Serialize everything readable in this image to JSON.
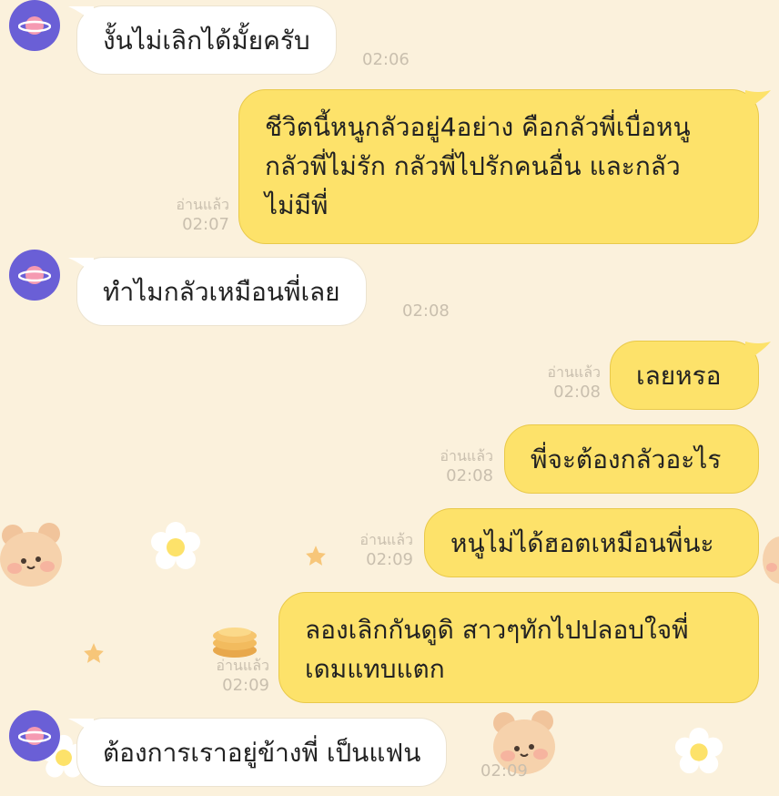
{
  "colors": {
    "background": "#fbf1dc",
    "incoming_bubble": "#ffffff",
    "outgoing_bubble": "#fde26a",
    "avatar": "#6a5fd6"
  },
  "messages": [
    {
      "direction": "incoming",
      "text": "งั้นไม่เลิกได้มั้ยครับ",
      "time": "02:06"
    },
    {
      "direction": "outgoing",
      "lines": [
        "ชีวิตนี้หนูกลัวอยู่4อย่าง คือกลัวพี่เบื่อหนู",
        "กลัวพี่ไม่รัก กลัวพี่ไปรักคนอื่น และกลัว",
        "ไม่มีพี่"
      ],
      "read": "อ่านแล้ว",
      "time": "02:07"
    },
    {
      "direction": "incoming",
      "text": "ทำไมกลัวเหมือนพี่เลย",
      "time": "02:08"
    },
    {
      "direction": "outgoing",
      "text": "เลยหรอ",
      "read": "อ่านแล้ว",
      "time": "02:08"
    },
    {
      "direction": "outgoing",
      "text": "พี่จะต้องกลัวอะไร",
      "read": "อ่านแล้ว",
      "time": "02:08"
    },
    {
      "direction": "outgoing",
      "text": "หนูไม่ได้ฮอตเหมือนพี่นะ",
      "read": "อ่านแล้ว",
      "time": "02:09"
    },
    {
      "direction": "outgoing",
      "lines": [
        "ลองเลิกกันดูดิ สาวๆทักไปปลอบใจพี่",
        "เดมแทบแตก"
      ],
      "read": "อ่านแล้ว",
      "time": "02:09"
    },
    {
      "direction": "incoming",
      "text": "ต้องการเราอยู่ข้างพี่ เป็นแฟน",
      "time": "02:09"
    }
  ]
}
